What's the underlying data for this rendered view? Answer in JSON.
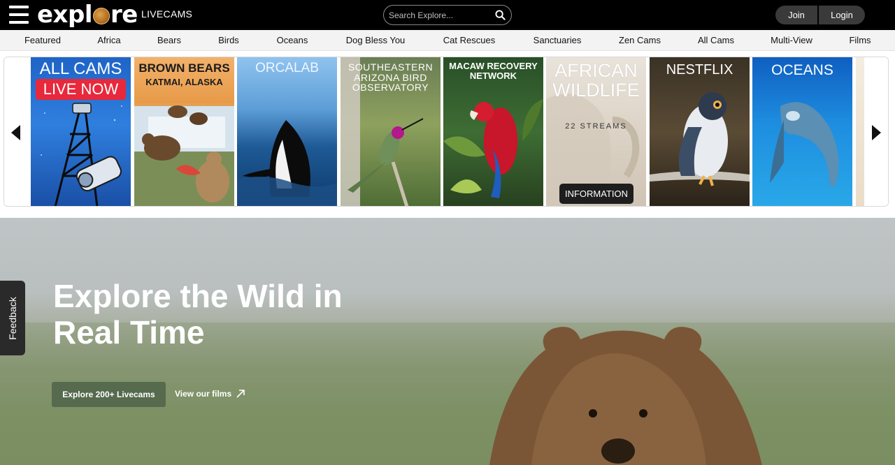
{
  "header": {
    "logo_text": "explore",
    "logo_sub": "LIVECAMS",
    "search_placeholder": "Search Explore...",
    "join_label": "Join",
    "login_label": "Login"
  },
  "categories": [
    "Featured",
    "Africa",
    "Bears",
    "Birds",
    "Oceans",
    "Dog Bless You",
    "Cat Rescues",
    "Sanctuaries",
    "Zen Cams",
    "All Cams",
    "Multi-View",
    "Films"
  ],
  "carousel": {
    "tiles": [
      {
        "title": "ALL CAMS",
        "badge": "LIVE NOW"
      },
      {
        "title": "BROWN BEARS",
        "subtitle": "KATMAI, ALASKA"
      },
      {
        "title": "ORCALAB"
      },
      {
        "title": "SOUTHEASTERN ARIZONA BIRD OBSERVATORY"
      },
      {
        "title": "MACAW RECOVERY NETWORK"
      },
      {
        "title": "AFRICAN WILDLIFE",
        "count": "22 STREAMS",
        "button": "INFORMATION"
      },
      {
        "title": "NESTFLIX"
      },
      {
        "title": "OCEANS"
      }
    ]
  },
  "hero": {
    "title": "Explore the Wild in Real Time",
    "primary_button": "Explore 200+ Livecams",
    "secondary_link": "View our films"
  },
  "feedback_label": "Feedback",
  "colors": {
    "header_bg": "#000000",
    "live_badge": "#e8283b",
    "hero_button": "#566a4e"
  }
}
